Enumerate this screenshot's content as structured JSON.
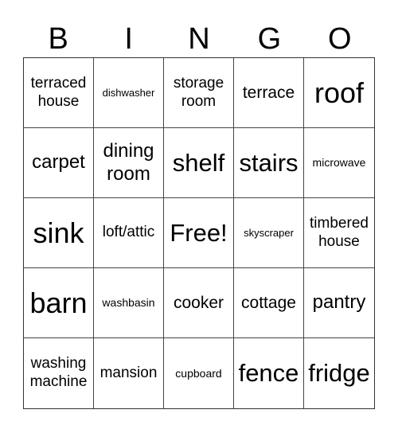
{
  "header": {
    "letters": [
      "B",
      "I",
      "N",
      "G",
      "O"
    ]
  },
  "grid": {
    "rows": [
      [
        "terraced house",
        "dishwasher",
        "storage room",
        "terrace",
        "roof"
      ],
      [
        "carpet",
        "dining room",
        "shelf",
        "stairs",
        "microwave"
      ],
      [
        "sink",
        "loft/attic",
        "Free!",
        "skyscraper",
        "timbered house"
      ],
      [
        "barn",
        "washbasin",
        "cooker",
        "cottage",
        "pantry"
      ],
      [
        "washing machine",
        "mansion",
        "cupboard",
        "fence",
        "fridge"
      ]
    ]
  }
}
